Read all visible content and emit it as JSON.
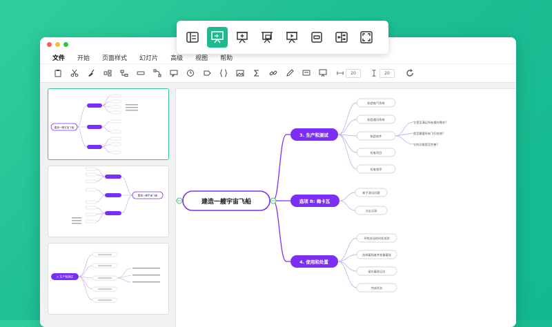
{
  "menu": {
    "items": [
      "文件",
      "开始",
      "页面样式",
      "幻灯片",
      "高级",
      "视图",
      "帮助"
    ]
  },
  "toolbar": {
    "width_value": "20",
    "height_value": "20"
  },
  "mindmap": {
    "root": "建造一艘宇宙飞船",
    "branches": [
      {
        "label": "3. 生产和测试",
        "children": [
          "制造电气系统",
          "制造通讯系统",
          "制造软件",
          "检查项目",
          "检查程序"
        ],
        "sub_children": [
          "它是否满足所有操作需求?",
          "是否需要所有飞行检修?",
          "它的功能是否完善?"
        ]
      },
      {
        "label": "选项 B: 梅卡瓦",
        "children": [
          "新手测试问题",
          "点击记录"
        ]
      },
      {
        "label": "4. 使用和处置",
        "children": [
          "寻找合适的时机发射",
          "选择着陆者并准备着陆",
          "留存着陆日志",
          "完成任务"
        ]
      }
    ]
  },
  "thumbnails": {
    "slide1_root": "建造一艘宇宙飞船",
    "slide2_root": "建造一艘宇宙飞船",
    "slide3_root": "3. 生产和测试"
  },
  "colors": {
    "accent": "#1eb98e",
    "purple": "#7b2ff2",
    "green_node": "#3dbf5a"
  }
}
